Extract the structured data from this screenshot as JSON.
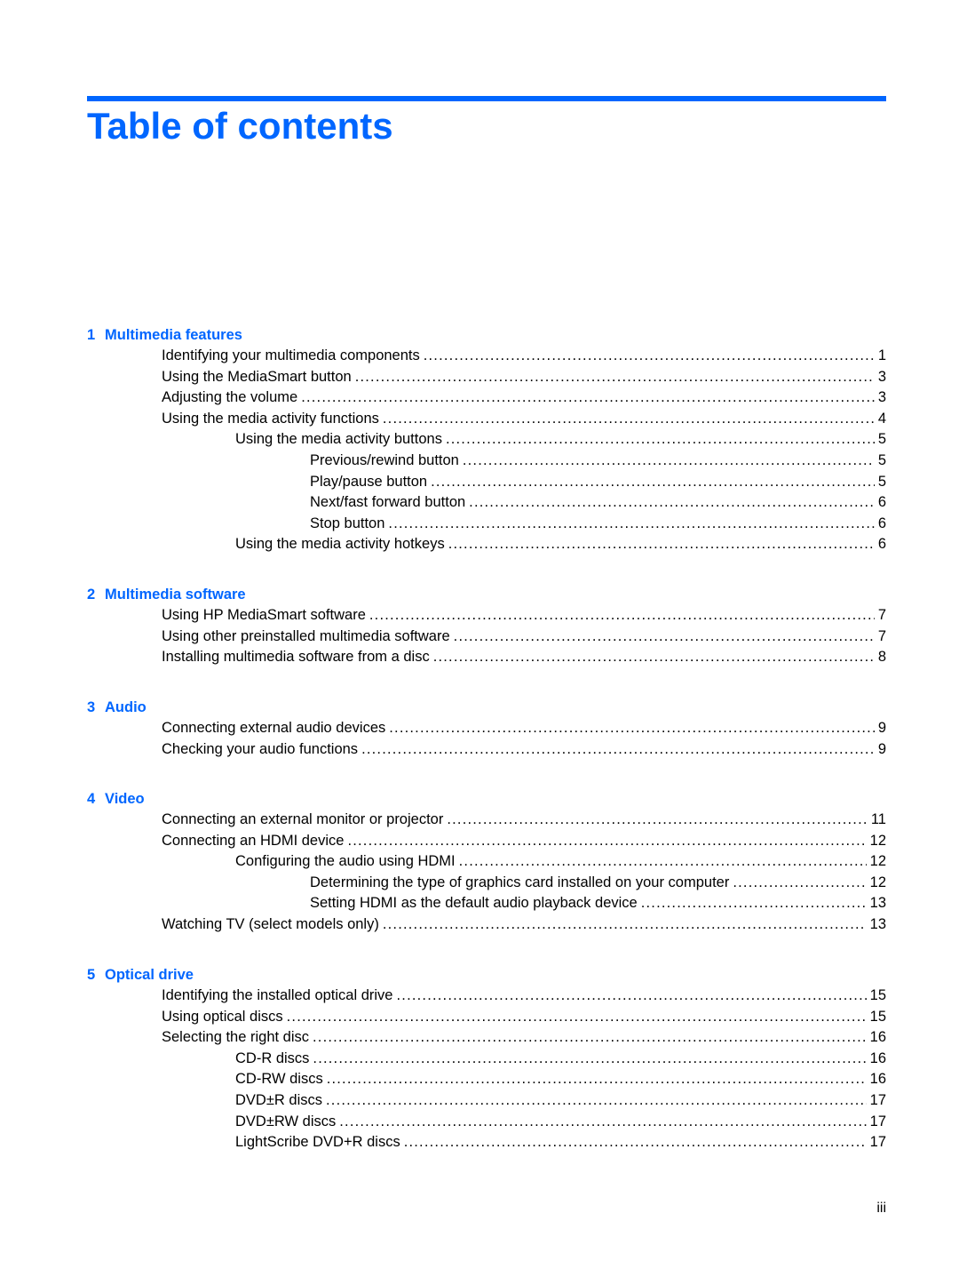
{
  "title": "Table of contents",
  "page_number": "iii",
  "colors": {
    "accent": "#0066ff",
    "text": "#000000"
  },
  "chapters": [
    {
      "number": "1",
      "title": "Multimedia features",
      "entries": [
        {
          "label": "Identifying your multimedia components",
          "page": "1",
          "level": 1
        },
        {
          "label": "Using the MediaSmart button",
          "page": "3",
          "level": 1
        },
        {
          "label": "Adjusting the volume",
          "page": "3",
          "level": 1
        },
        {
          "label": "Using the media activity functions",
          "page": "4",
          "level": 1
        },
        {
          "label": "Using the media activity buttons",
          "page": "5",
          "level": 2
        },
        {
          "label": "Previous/rewind button",
          "page": "5",
          "level": 3
        },
        {
          "label": "Play/pause button",
          "page": "5",
          "level": 3
        },
        {
          "label": "Next/fast forward button",
          "page": "6",
          "level": 3
        },
        {
          "label": "Stop button",
          "page": "6",
          "level": 3
        },
        {
          "label": "Using the media activity hotkeys",
          "page": "6",
          "level": 2
        }
      ]
    },
    {
      "number": "2",
      "title": "Multimedia software",
      "entries": [
        {
          "label": "Using HP MediaSmart software",
          "page": "7",
          "level": 1
        },
        {
          "label": "Using other preinstalled multimedia software",
          "page": "7",
          "level": 1
        },
        {
          "label": "Installing multimedia software from a disc",
          "page": "8",
          "level": 1
        }
      ]
    },
    {
      "number": "3",
      "title": "Audio",
      "entries": [
        {
          "label": "Connecting external audio devices",
          "page": "9",
          "level": 1
        },
        {
          "label": "Checking your audio functions",
          "page": "9",
          "level": 1
        }
      ]
    },
    {
      "number": "4",
      "title": "Video",
      "entries": [
        {
          "label": "Connecting an external monitor or projector",
          "page": "11",
          "level": 1
        },
        {
          "label": "Connecting an HDMI device",
          "page": "12",
          "level": 1
        },
        {
          "label": "Configuring the audio using HDMI",
          "page": "12",
          "level": 2
        },
        {
          "label": "Determining the type of graphics card installed on your computer",
          "page": "12",
          "level": 3
        },
        {
          "label": "Setting HDMI as the default audio playback device",
          "page": "13",
          "level": 3
        },
        {
          "label": "Watching TV (select models only)",
          "page": "13",
          "level": 1
        }
      ]
    },
    {
      "number": "5",
      "title": "Optical drive",
      "entries": [
        {
          "label": "Identifying the installed optical drive",
          "page": "15",
          "level": 1
        },
        {
          "label": "Using optical discs",
          "page": "15",
          "level": 1
        },
        {
          "label": "Selecting the right disc",
          "page": "16",
          "level": 1
        },
        {
          "label": "CD-R discs",
          "page": "16",
          "level": 2
        },
        {
          "label": "CD-RW discs",
          "page": "16",
          "level": 2
        },
        {
          "label": "DVD±R discs",
          "page": "17",
          "level": 2
        },
        {
          "label": "DVD±RW discs",
          "page": "17",
          "level": 2
        },
        {
          "label": "LightScribe DVD+R discs",
          "page": "17",
          "level": 2
        }
      ]
    }
  ]
}
